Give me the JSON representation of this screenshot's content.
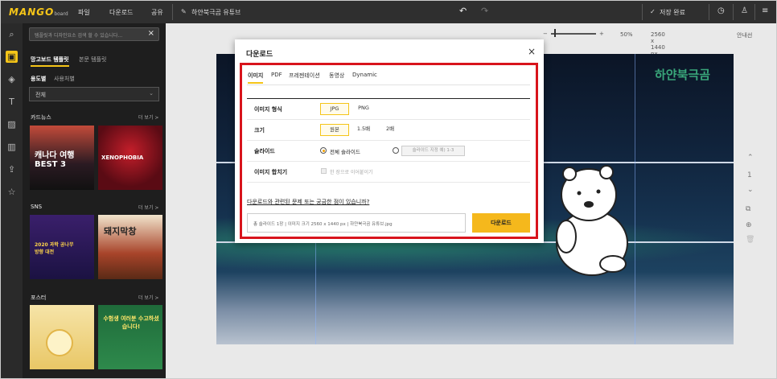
{
  "topbar": {
    "logo": "MANGO",
    "logo_sub": "board",
    "menu": [
      "파일",
      "다운로드",
      "공유"
    ],
    "doc_title": "하얀북극곰 유튜브",
    "save_status": "저장 완료"
  },
  "sidebar": {
    "search_placeholder": "템플릿과 디자인요소 검색 할 수 있습니다...",
    "tabs": [
      "망고보드 템플릿",
      "본문 템플릿"
    ],
    "filter_primary": "용도별",
    "filter_secondary": "사용처별",
    "dropdown_value": "전체",
    "sections": [
      {
        "title": "카드뉴스",
        "more": "더 보기 >"
      },
      {
        "title": "SNS",
        "more": "더 보기 >"
      },
      {
        "title": "포스터",
        "more": "더 보기 >"
      }
    ],
    "thumbs": [
      "캐나다 여행 BEST 3",
      "XENOPHOBIA",
      "2020 과학 공나무 방향 대전",
      "돼지막창",
      "",
      "수험생 여러분 수고하셨습니다!"
    ]
  },
  "canvas_toolbar": {
    "zoom": "50%",
    "size": "2560 x 1440 px",
    "guide": "안내선"
  },
  "artwork": {
    "brand_text": "하얀북극곰"
  },
  "rightrail": {
    "page_number": "1"
  },
  "dialog": {
    "title": "다운로드",
    "tabs": [
      "이미지",
      "PDF",
      "프레젠테이션",
      "동영상",
      "Dynamic"
    ],
    "rows": {
      "format_label": "이미지 형식",
      "format_options": [
        "JPG",
        "PNG"
      ],
      "size_label": "크기",
      "size_options": [
        "원본",
        "1.5배",
        "2배"
      ],
      "slide_label": "슬라이드",
      "slide_all": "전체 슬라이드",
      "slide_range_placeholder": "슬라이드 지정 예) 1-3",
      "merge_label": "이미지 합치기",
      "merge_option": "한 장으로 이어붙이기"
    },
    "help_link": "다운로드와 관련된 문제 또는 궁금한 점이 있습니까?",
    "info": "총 슬라이드 1장  |  이미지 크기 2560 x 1440 px  |  하얀북극곰 유튜브.jpg",
    "download_button": "다운로드"
  }
}
